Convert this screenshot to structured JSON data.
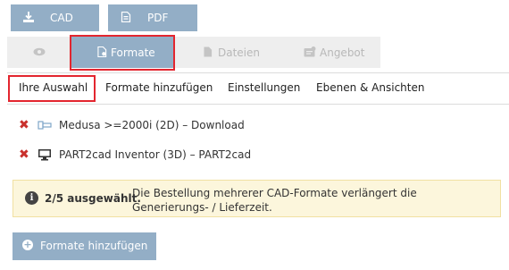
{
  "top_buttons": {
    "cad_label": "CAD",
    "pdf_label": "PDF"
  },
  "tabs": [
    {
      "label": "",
      "icon": "eye-icon"
    },
    {
      "label": "Formate",
      "icon": "file-settings-icon",
      "active": true
    },
    {
      "label": "Dateien",
      "icon": "file-icon"
    },
    {
      "label": "Angebot",
      "icon": "quote-icon"
    }
  ],
  "subnav": [
    {
      "label": "Ihre Auswahl",
      "active": true
    },
    {
      "label": "Formate hinzufügen"
    },
    {
      "label": "Einstellungen"
    },
    {
      "label": "Ebenen & Ansichten"
    }
  ],
  "formats": [
    {
      "text": "Medusa >=2000i (2D) – Download",
      "icon": "2d-icon"
    },
    {
      "text": "PART2cad Inventor (3D) – PART2cad",
      "icon": "monitor-icon"
    }
  ],
  "alert": {
    "count_text": "2/5 ausgewählt.",
    "message": "Die Bestellung mehrerer CAD-Formate verlängert die Generierungs- / Lieferzeit."
  },
  "add_button_label": "Formate hinzufügen",
  "colors": {
    "accent": "#93aec6",
    "highlight": "#e3262f",
    "remove": "#c9302c",
    "alert_bg": "#fcf6dc"
  }
}
